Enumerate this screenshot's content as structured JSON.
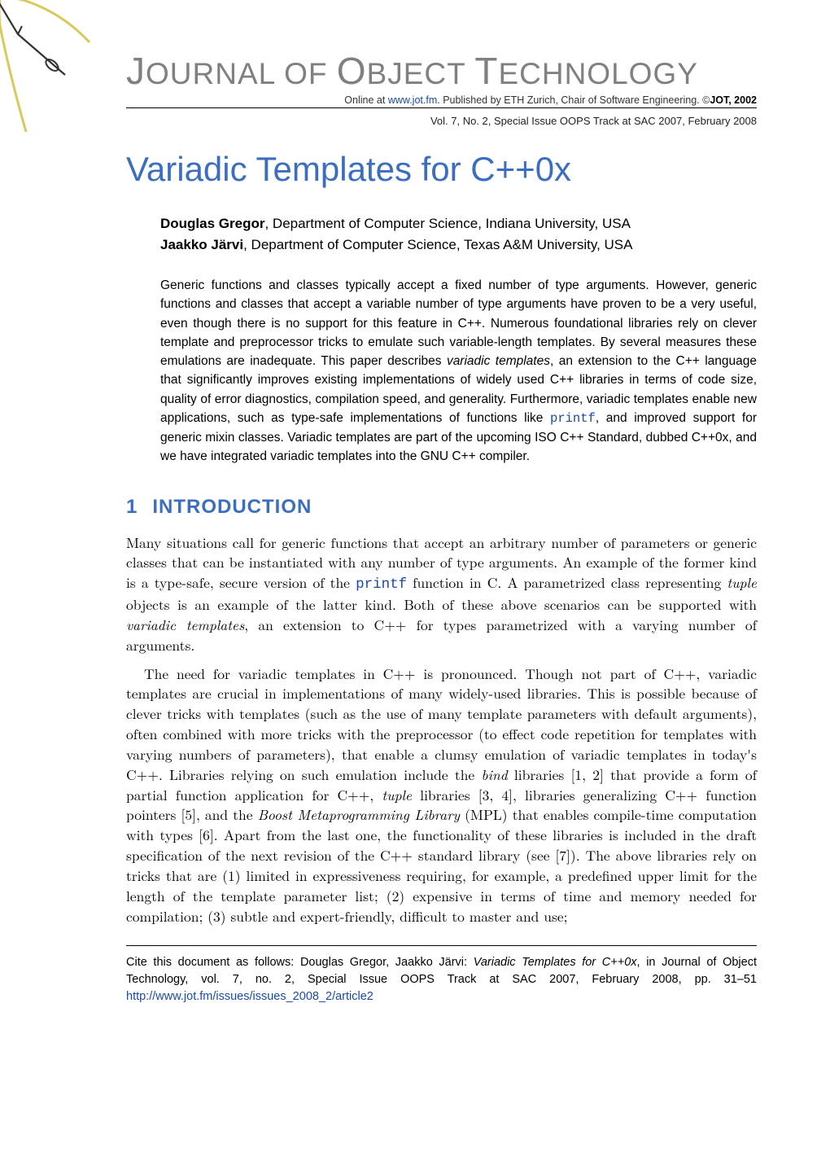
{
  "journal": {
    "title_leading_J": "J",
    "title_rest_1": "OURNAL OF ",
    "title_leading_O": "O",
    "title_rest_2": "BJECT ",
    "title_leading_T": "T",
    "title_rest_3": "ECHNOLOGY",
    "online_prefix": "Online at ",
    "online_url_text": "www.jot.fm",
    "online_suffix": ". Published by ETH Zurich, Chair of Software Engineering. ©",
    "copyright_bold": "JOT, 2002",
    "issue_line": "Vol. 7, No. 2, Special Issue OOPS Track at SAC 2007, February 2008"
  },
  "paper": {
    "title": "Variadic Templates for C++0x",
    "authors": [
      {
        "name": "Douglas Gregor",
        "affiliation": ", Department of Computer Science, Indiana University, USA"
      },
      {
        "name": "Jaakko Järvi",
        "affiliation": ", Department of Computer Science, Texas A&M University, USA"
      }
    ],
    "abstract_parts": {
      "p1a": "Generic functions and classes typically accept a fixed number of type arguments. However, generic functions and classes that accept a variable number of type arguments have proven to be a very useful, even though there is no support for this feature in C++. Numerous foundational libraries rely on clever template and preprocessor tricks to emulate such variable-length templates.  By several measures these emulations are inadequate. This paper describes ",
      "term1": "variadic templates",
      "p1b": ", an extension to the C++ language that significantly improves existing implementations of widely used C++ libraries in terms of code size, quality of error diagnostics, compilation speed, and generality. Furthermore, variadic templates enable new applications, such as type-safe implementations of functions like ",
      "code1": "printf",
      "p1c": ", and improved support for generic mixin classes. Variadic templates are part of the upcoming ISO C++ Standard, dubbed C++0x, and we have integrated variadic templates into the GNU C++ compiler."
    }
  },
  "section1": {
    "num": "1",
    "title": "INTRODUCTION",
    "para1a": "Many situations call for generic functions that accept an arbitrary number of parameters or generic classes that can be instantiated with any number of type arguments. An example of the former kind is a type-safe, secure version of the ",
    "para1_code": "printf",
    "para1b": " function in C. A parametrized class representing ",
    "para1_it1": "tuple",
    "para1c": " objects is an example of the latter kind. Both of these above scenarios can be supported with ",
    "para1_it2": "variadic templates",
    "para1d": ", an extension to C++ for types parametrized with a varying number of arguments.",
    "para2a": "The need for variadic templates in C++ is pronounced. Though not part of C++, variadic templates are crucial in implementations of many widely-used libraries. This is possible because of clever tricks with templates (such as the use of many template parameters with default arguments), often combined with more tricks with the preprocessor (to effect code repetition for templates with varying numbers of parameters), that enable a clumsy emulation of variadic templates in today's C++. Libraries relying on such emulation include the ",
    "para2_it1": "bind",
    "para2b": " libraries [1, 2] that provide a form of partial function application for C++, ",
    "para2_it2": "tuple",
    "para2c": " libraries [3, 4], libraries generalizing C++ function pointers [5], and the ",
    "para2_it3": "Boost Metaprogramming Library",
    "para2d": " (MPL) that enables compile-time computation with types [6]. Apart from the last one, the functionality of these libraries is included in the draft specification of the next revision of the C++ standard library (see [7]).  The above libraries rely on tricks that are (1) limited in expressiveness requiring, for example, a predefined upper limit for the length of the template parameter list; (2) expensive in terms of time and memory needed for compilation; (3) subtle and expert-friendly, difficult to master and use;"
  },
  "footer": {
    "text_a": "Cite this document as follows: Douglas Gregor, Jaakko Järvi: ",
    "it": "Variadic Templates for C++0x",
    "text_b": ", in Journal of Object Technology, vol. 7, no. 2, Special Issue OOPS Track at SAC 2007, February 2008, pp. 31–51 ",
    "link_text": "http://www.jot.fm/issues/issues_2008_2/article2"
  }
}
